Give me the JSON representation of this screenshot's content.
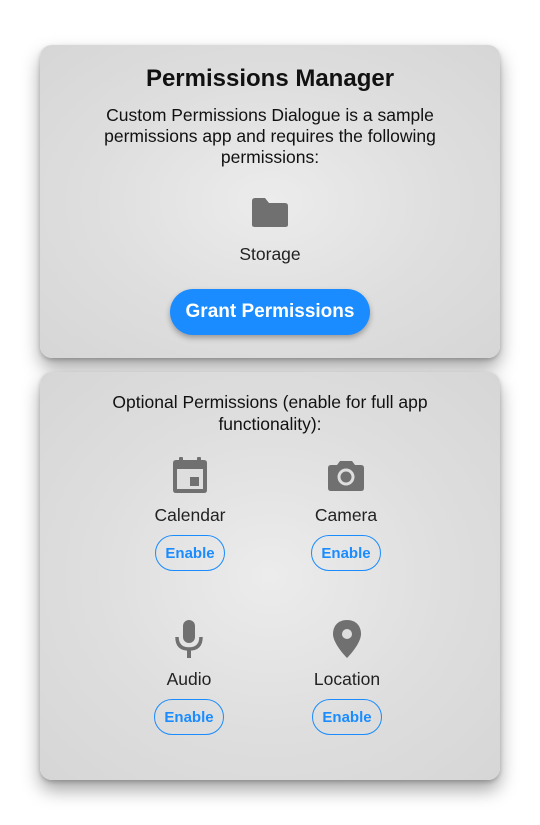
{
  "main_card": {
    "title": "Permissions Manager",
    "description": "Custom Permissions Dialogue is a sample permissions app and requires the following permissions:",
    "required": [
      {
        "label": "Storage",
        "icon": "folder-icon"
      }
    ],
    "grant_button_label": "Grant Permissions"
  },
  "optional_card": {
    "heading": "Optional Permissions (enable for full app functionality):",
    "items": [
      {
        "label": "Calendar",
        "icon": "calendar-icon",
        "button_label": "Enable"
      },
      {
        "label": "Camera",
        "icon": "camera-icon",
        "button_label": "Enable"
      },
      {
        "label": "Audio",
        "icon": "microphone-icon",
        "button_label": "Enable"
      },
      {
        "label": "Location",
        "icon": "location-pin-icon",
        "button_label": "Enable"
      }
    ]
  },
  "colors": {
    "accent": "#1a8cff",
    "icon_gray": "#707070",
    "card_background": "#dedede"
  }
}
